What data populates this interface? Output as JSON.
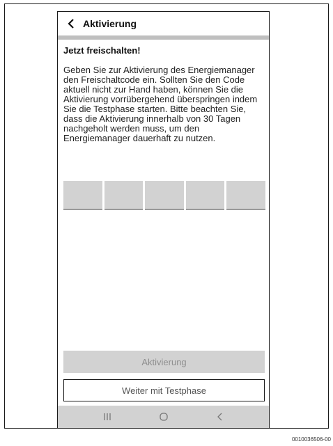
{
  "header": {
    "title": "Aktivierung",
    "back_icon": "chevron-left-icon"
  },
  "main": {
    "heading": "Jetzt freischalten!",
    "paragraph": "Geben Sie zur Aktivierung des Energiemanager den Freischaltcode ein. Sollten Sie den Code aktuell nicht zur Hand haben, können Sie die Aktivierung vorrübergehend überspringen indem Sie die Testphase starten. Bitte beachten Sie, dass die Aktivierung innerhalb von 30 Tagen nachgeholt werden muss, um den Energiemanager dauerhaft zu nutzen.",
    "code_fields": [
      "",
      "",
      "",
      "",
      ""
    ]
  },
  "buttons": {
    "activate_label": "Aktivierung",
    "trial_label": "Weiter mit Testphase"
  },
  "navbar": {
    "icons": [
      "recent-apps-icon",
      "home-icon",
      "back-icon"
    ]
  },
  "figure_ref": "0010036506-00",
  "colors": {
    "field": "#d2d2d2",
    "disabled_text": "#8e8e8e",
    "border": "#1a1a1a"
  }
}
